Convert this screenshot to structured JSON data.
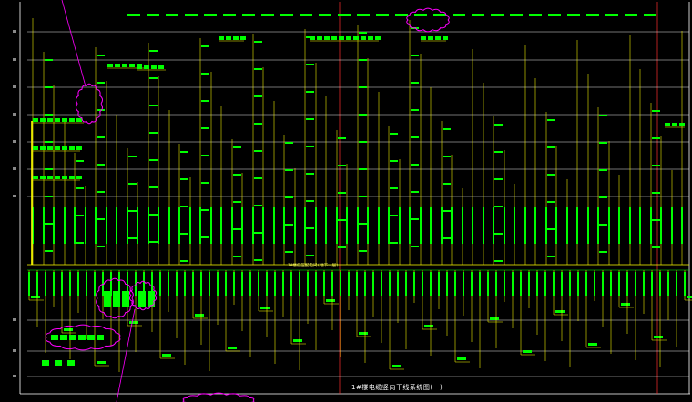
{
  "drawing": {
    "caption": "1#楼电缆竖向干线系统图(一)",
    "bus_label": "1#楼低压配电间(地下一层)",
    "colors": {
      "background": "#000000",
      "grid": "#ffffff",
      "feeder": "#ffff00",
      "text": "#00ff00",
      "revision_cloud": "#ff00ff",
      "border": "#ffffff",
      "red_divider": "#ff3030"
    },
    "floor_markers": [
      "17F",
      "16F",
      "15F",
      "14F",
      "13F",
      "12F",
      "11F",
      "10F",
      "9F",
      "B1",
      "B2",
      "B3"
    ]
  }
}
